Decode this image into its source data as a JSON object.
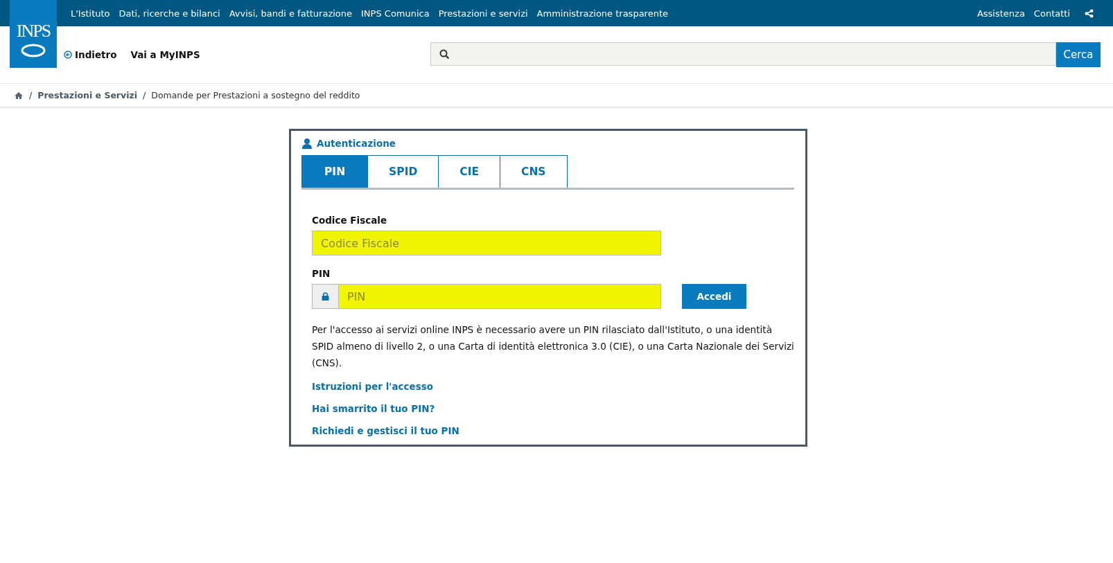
{
  "logo": {
    "text": "INPS"
  },
  "top_nav": {
    "links": [
      "L'Istituto",
      "Dati, ricerche e bilanci",
      "Avvisi, bandi e fatturazione",
      "INPS Comunica",
      "Prestazioni e servizi",
      "Amministrazione trasparente"
    ],
    "right_links": [
      "Assistenza",
      "Contatti"
    ]
  },
  "header": {
    "back": "Indietro",
    "myinps": "Vai a MyINPS",
    "search": {
      "button": "Cerca"
    }
  },
  "breadcrumb": {
    "separator": "/",
    "items": [
      "Prestazioni e Servizi",
      "Domande per Prestazioni a sostegno del reddito"
    ]
  },
  "auth": {
    "title": "Autenticazione",
    "tabs": [
      {
        "label": "PIN",
        "selected": true
      },
      {
        "label": "SPID",
        "selected": false
      },
      {
        "label": "CIE",
        "selected": false
      },
      {
        "label": "CNS",
        "selected": false
      }
    ],
    "fields": [
      {
        "label": "Codice Fiscale",
        "placeholder": "Codice Fiscale",
        "kind": "text"
      },
      {
        "label": "PIN",
        "placeholder": "PIN",
        "kind": "password"
      }
    ],
    "submit": "Accedi",
    "info": "Per l'accesso ai servizi online INPS è necessario avere un PIN rilasciato dall'Istituto, o una identità SPID almeno di livello 2, o una Carta di identità elettronica 3.0 (CIE), o una Carta Nazionale dei Servizi (CNS).",
    "links": [
      "Istruzioni per l'accesso",
      "Hai smarrito il tuo PIN?",
      "Richiedi e gestisci il tuo PIN"
    ]
  }
}
